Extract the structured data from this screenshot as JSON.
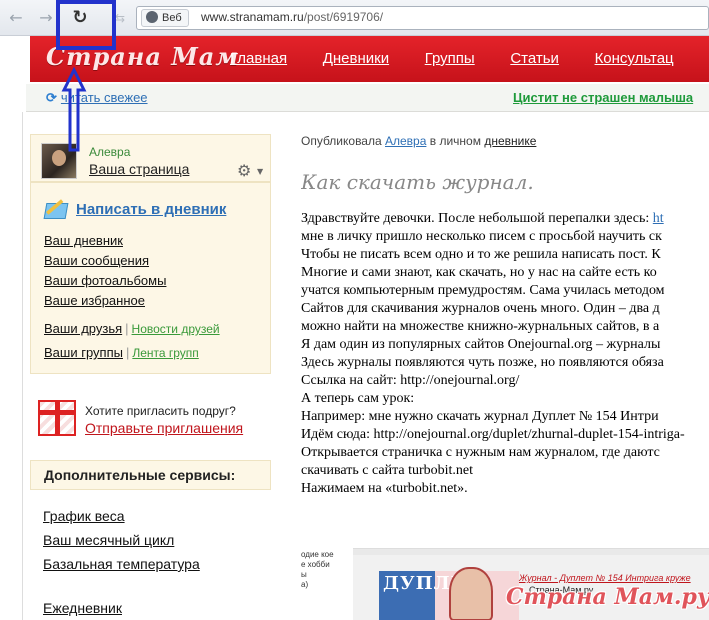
{
  "browser": {
    "back_glyph": "←",
    "forward_glyph": "→",
    "reload_glyph": "↻",
    "extra_glyph": "⇆",
    "site_chip": "Веб",
    "url_host": "www.stranamam.ru",
    "url_path": "/post/6919706/"
  },
  "annotation": {
    "color": "#2233cc"
  },
  "site": {
    "logo": "Страна Мам",
    "nav": [
      "Главная",
      "Дневники",
      "Группы",
      "Статьи",
      "Консультац"
    ],
    "brand_color": "#d41c23"
  },
  "infobar": {
    "refresh_label": "читать свежее",
    "promo_label": "Цистит не страшен малыша"
  },
  "sidebar": {
    "user": {
      "name": "Алевра",
      "page_label": "Ваша страница"
    },
    "write_label": "Написать в дневник",
    "menu": [
      "Ваш дневник",
      "Ваши сообщения",
      "Ваши фотоальбомы",
      "Ваше избранное"
    ],
    "friends_label": "Ваши друзья",
    "friends_news_label": "Новости друзей",
    "groups_label": "Ваши группы",
    "groups_feed_label": "Лента групп",
    "invite_question": "Хотите пригласить подруг?",
    "invite_link": "Отправьте приглашения",
    "services_title": "Дополнительные сервисы:",
    "services": [
      "График веса",
      "Ваш месячный цикл",
      "Базальная температура"
    ],
    "diary_label": "Ежедневник"
  },
  "post": {
    "byline_prefix": "Опубликовала",
    "author": "Алевра",
    "byline_mid": "в личном",
    "diary_link": "дневнике",
    "title": "Как скачать журнал.",
    "lines": [
      "Здравствуйте девочки. После небольшой перепалки здесь:",
      "мне в личку пришло несколько писем с просьбой научить ск",
      "Чтобы не писать всем одно и то же решила написать пост. К",
      "Многие и сами знают, как скачать, но у нас на сайте есть ко",
      "учатся компьютерным премудростям. Сама училась методом",
      "Сайтов для скачивания журналов очень много. Один – два д",
      "можно найти на множестве книжно-журнальных сайтов, в а",
      "Я дам один из популярных сайтов Onejournal.org – журналы",
      "Здесь журналы появляются чуть позже, но появляются обяза",
      "Ссылка на сайт: http://onejournal.org/",
      "А теперь сам урок:",
      "Например: мне нужно скачать журнал Дуплет № 154 Интри",
      "Идём сюда: http://onejournal.org/duplet/zhurnal-duplet-154-intriga-",
      "Открывается страничка с нужным нам журналом, где даютс",
      "скачивать с сайта turbobit.net",
      "Нажимаем на «turbobit.net»."
    ],
    "first_line_link": "ht"
  },
  "embed": {
    "left_snippet": [
      "одие кое",
      "е хобби",
      "",
      "ы",
      "а)"
    ],
    "mag_title": "ДУПЛЕТ",
    "headline": "Журнал - Дуплет № 154 Интрига круже",
    "sub": "Страна-Мам.ру"
  },
  "watermark": "Страна Мам.ру"
}
